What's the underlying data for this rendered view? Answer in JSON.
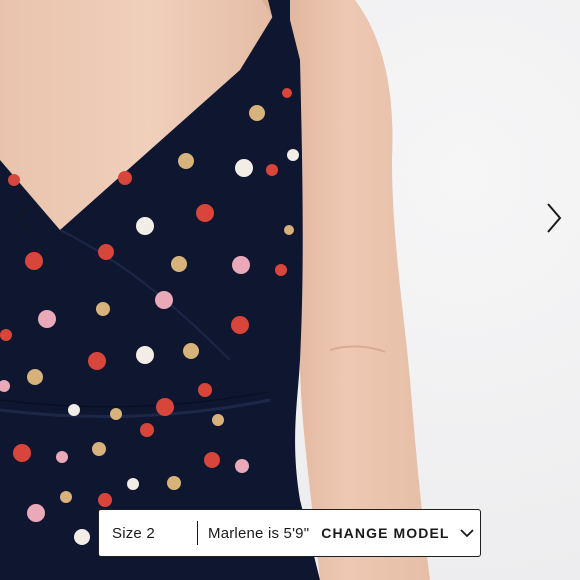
{
  "image": {
    "description_icon": "product-photo",
    "colors": {
      "background": "#f1f1f2",
      "skin": "#ecc9b4",
      "dress": "#0f1630"
    }
  },
  "gallery": {
    "prev_icon": "chevron-left-icon",
    "next_icon": "chevron-right-icon"
  },
  "model_selector": {
    "size_label": "Size 2",
    "model_text": "Marlene is 5'9\"",
    "change_label": "CHANGE MODEL",
    "dropdown_icon": "chevron-down-icon"
  }
}
